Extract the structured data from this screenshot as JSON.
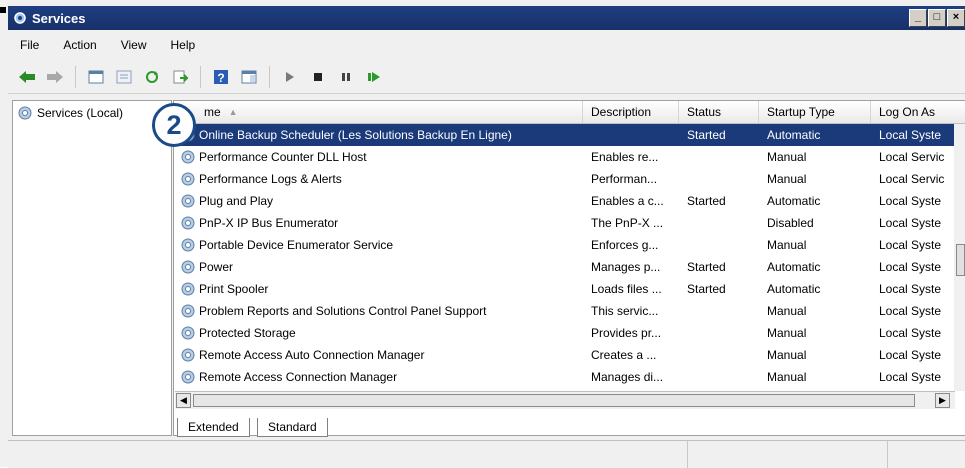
{
  "window": {
    "title": "Services"
  },
  "menu": [
    "File",
    "Action",
    "View",
    "Help"
  ],
  "toolbar": {
    "icons": [
      "back-arrow-icon",
      "forward-arrow-icon",
      "console-tree-icon",
      "properties-icon",
      "refresh-icon",
      "export-list-icon",
      "help-icon",
      "show-hide-icon",
      "play-icon",
      "stop-icon",
      "pause-icon",
      "restart-icon"
    ]
  },
  "tree": {
    "root_label": "Services (Local)"
  },
  "columns": {
    "name": "Name",
    "name_visible": "me",
    "description": "Description",
    "status": "Status",
    "startup": "Startup Type",
    "logon": "Log On As"
  },
  "services": [
    {
      "name": "Online Backup Scheduler (Les Solutions Backup En Ligne)",
      "description": "",
      "status": "Started",
      "startup": "Automatic",
      "logon": "Local Syste",
      "selected": true
    },
    {
      "name": "Performance Counter DLL Host",
      "description": "Enables re...",
      "status": "",
      "startup": "Manual",
      "logon": "Local Servic"
    },
    {
      "name": "Performance Logs & Alerts",
      "description": "Performan...",
      "status": "",
      "startup": "Manual",
      "logon": "Local Servic"
    },
    {
      "name": "Plug and Play",
      "description": "Enables a c...",
      "status": "Started",
      "startup": "Automatic",
      "logon": "Local Syste"
    },
    {
      "name": "PnP-X IP Bus Enumerator",
      "description": "The PnP-X ...",
      "status": "",
      "startup": "Disabled",
      "logon": "Local Syste"
    },
    {
      "name": "Portable Device Enumerator Service",
      "description": "Enforces g...",
      "status": "",
      "startup": "Manual",
      "logon": "Local Syste"
    },
    {
      "name": "Power",
      "description": "Manages p...",
      "status": "Started",
      "startup": "Automatic",
      "logon": "Local Syste"
    },
    {
      "name": "Print Spooler",
      "description": "Loads files ...",
      "status": "Started",
      "startup": "Automatic",
      "logon": "Local Syste"
    },
    {
      "name": "Problem Reports and Solutions Control Panel Support",
      "description": "This servic...",
      "status": "",
      "startup": "Manual",
      "logon": "Local Syste"
    },
    {
      "name": "Protected Storage",
      "description": "Provides pr...",
      "status": "",
      "startup": "Manual",
      "logon": "Local Syste"
    },
    {
      "name": "Remote Access Auto Connection Manager",
      "description": "Creates a ...",
      "status": "",
      "startup": "Manual",
      "logon": "Local Syste"
    },
    {
      "name": "Remote Access Connection Manager",
      "description": "Manages di...",
      "status": "",
      "startup": "Manual",
      "logon": "Local Syste"
    }
  ],
  "tabs": [
    "Extended",
    "Standard"
  ],
  "callout": {
    "number": "2"
  },
  "colors": {
    "titlebar": "#1f3f82",
    "selection": "#1a3a7a",
    "callout": "#1b4a8a"
  }
}
